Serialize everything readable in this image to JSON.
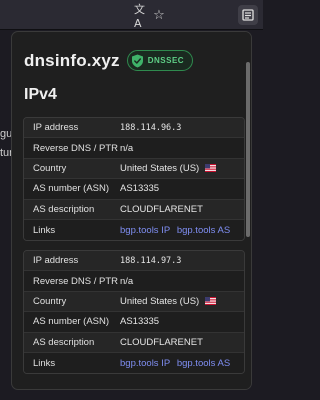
{
  "toolbar": {
    "translate_icon": "translate-icon",
    "star_icon": "star-icon",
    "extension_icon": "dnsinfo-extension-icon"
  },
  "background_page": {
    "fragments": [
      "gue",
      "tur"
    ]
  },
  "popup": {
    "domain": "dnsinfo.xyz",
    "dnssec_badge": "DNSSEC",
    "section_title": "IPv4",
    "records": [
      {
        "ip_address_label": "IP address",
        "ip_address": "188.114.96.3",
        "reverse_dns_label": "Reverse DNS / PTR",
        "reverse_dns": "n/a",
        "country_label": "Country",
        "country": "United States (US)",
        "asn_label": "AS number (ASN)",
        "asn": "AS13335",
        "as_desc_label": "AS description",
        "as_desc": "CLOUDFLARENET",
        "links_label": "Links",
        "links": [
          "bgp.tools IP",
          "bgp.tools AS"
        ]
      },
      {
        "ip_address_label": "IP address",
        "ip_address": "188.114.97.3",
        "reverse_dns_label": "Reverse DNS / PTR",
        "reverse_dns": "n/a",
        "country_label": "Country",
        "country": "United States (US)",
        "asn_label": "AS number (ASN)",
        "asn": "AS13335",
        "as_desc_label": "AS description",
        "as_desc": "CLOUDFLARENET",
        "links_label": "Links",
        "links": [
          "bgp.tools IP",
          "bgp.tools AS"
        ]
      }
    ]
  },
  "colors": {
    "accent_link": "#7f8ef2",
    "dnssec_green": "#2f8a4e"
  }
}
